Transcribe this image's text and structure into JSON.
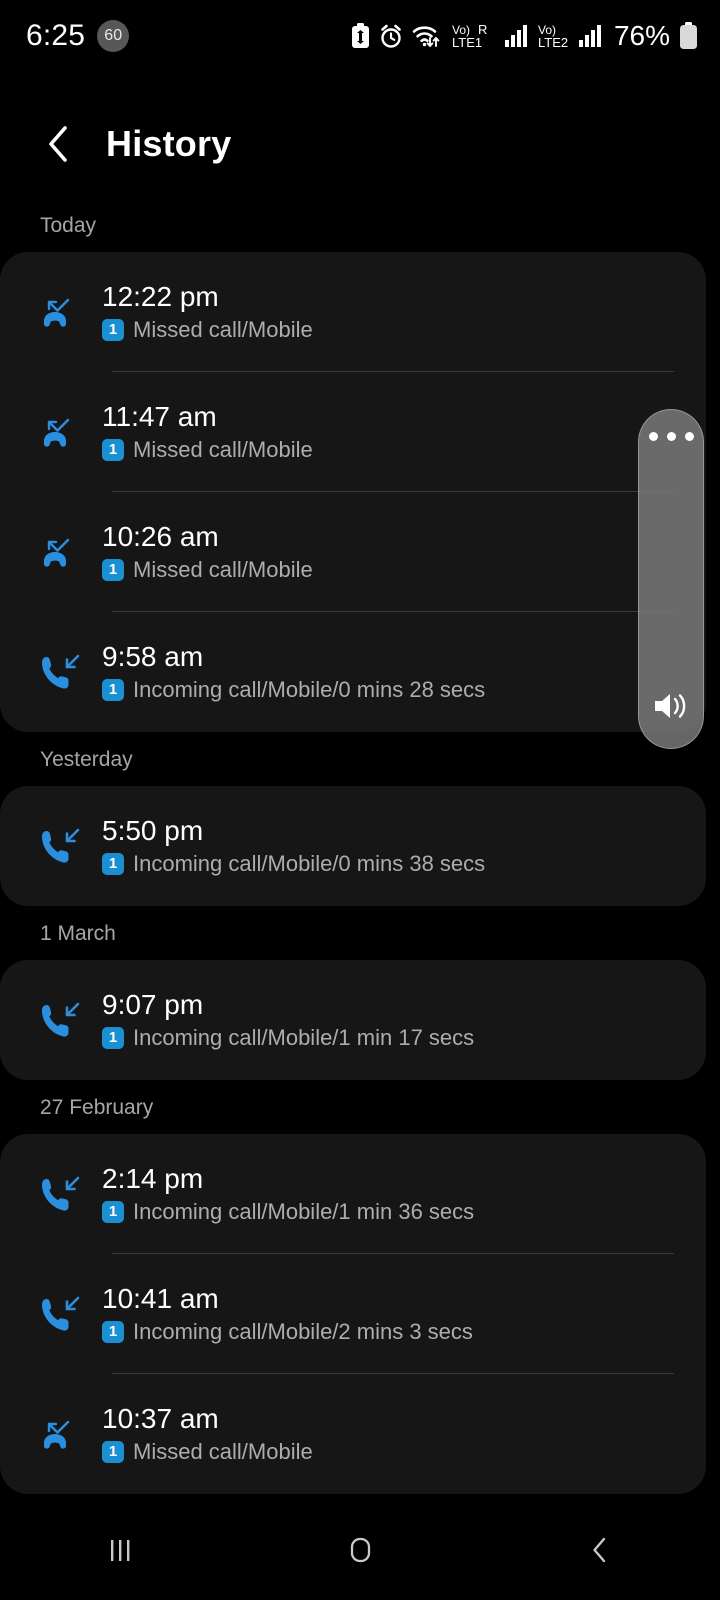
{
  "status_bar": {
    "time": "6:25",
    "notification_count": "60",
    "battery_percent": "76%",
    "icons": [
      {
        "name": "battery-saver-icon"
      },
      {
        "name": "alarm-icon"
      },
      {
        "name": "wifi-icon"
      },
      {
        "name": "volte-sim1-icon",
        "label_top": "Vo)",
        "label_bottom": "LTE1"
      },
      {
        "name": "roaming-icon",
        "label": "R"
      },
      {
        "name": "signal-sim1-icon"
      },
      {
        "name": "volte-sim2-icon",
        "label_top": "Vo)",
        "label_bottom": "LTE2"
      },
      {
        "name": "signal-sim2-icon"
      },
      {
        "name": "battery-icon"
      }
    ]
  },
  "header": {
    "back_label": "back",
    "title": "History"
  },
  "groups": [
    {
      "label": "Today",
      "entries": [
        {
          "icon": "missed-call-icon",
          "time": "12:22 pm",
          "sim": "1",
          "description": "Missed call/Mobile",
          "divider": true
        },
        {
          "icon": "missed-call-icon",
          "time": "11:47 am",
          "sim": "1",
          "description": "Missed call/Mobile",
          "divider": true
        },
        {
          "icon": "missed-call-icon",
          "time": "10:26 am",
          "sim": "1",
          "description": "Missed call/Mobile",
          "divider": true
        },
        {
          "icon": "incoming-call-icon",
          "time": "9:58 am",
          "sim": "1",
          "description": "Incoming call/Mobile/0 mins 28 secs",
          "divider": false
        }
      ]
    },
    {
      "label": "Yesterday",
      "entries": [
        {
          "icon": "incoming-call-icon",
          "time": "5:50 pm",
          "sim": "1",
          "description": "Incoming call/Mobile/0 mins 38 secs",
          "divider": false
        }
      ]
    },
    {
      "label": "1 March",
      "entries": [
        {
          "icon": "incoming-call-icon",
          "time": "9:07 pm",
          "sim": "1",
          "description": "Incoming call/Mobile/1 min 17 secs",
          "divider": false
        }
      ]
    },
    {
      "label": "27 February",
      "entries": [
        {
          "icon": "incoming-call-icon",
          "time": "2:14 pm",
          "sim": "1",
          "description": "Incoming call/Mobile/1 min 36 secs",
          "divider": true
        },
        {
          "icon": "incoming-call-icon",
          "time": "10:41 am",
          "sim": "1",
          "description": "Incoming call/Mobile/2 mins 3 secs",
          "divider": true
        },
        {
          "icon": "missed-call-icon",
          "time": "10:37 am",
          "sim": "1",
          "description": "Missed call/Mobile",
          "divider": false
        }
      ]
    }
  ],
  "volume_panel": {
    "more_options_label": "more-options",
    "speaker_label": "media-volume"
  },
  "nav_bar": {
    "recents_label": "Recents",
    "home_label": "Home",
    "back_label": "Back"
  },
  "colors": {
    "accent_blue": "#2b8fe0",
    "sim_badge": "#1a8fd1",
    "card_bg": "#161616",
    "screen_bg": "#000000",
    "secondary_text": "#adadad",
    "group_label_text": "#a6a6a6"
  }
}
